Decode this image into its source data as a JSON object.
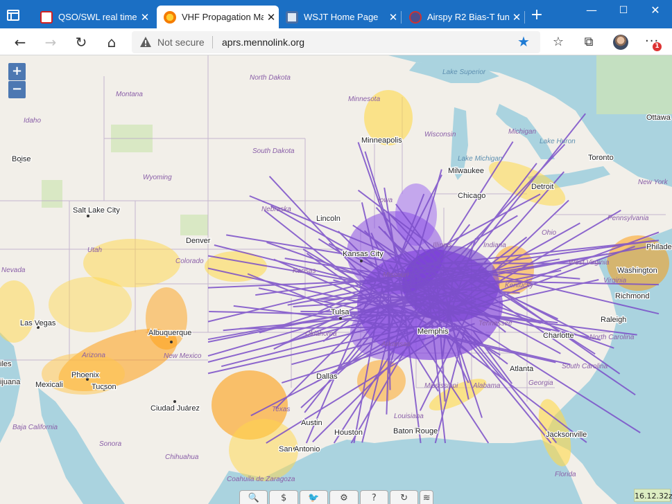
{
  "browser": {
    "tabs": [
      {
        "title": "QSO/SWL real time r",
        "fav_color": "#d32020"
      },
      {
        "title": "VHF Propagation Ma",
        "fav_color": "#f57c00"
      },
      {
        "title": "WSJT Home Page",
        "fav_color": "#4a6fa5"
      },
      {
        "title": "Airspy R2 Bias-T func",
        "fav_color": "#4e4e8c"
      }
    ],
    "active_tab": 1,
    "new_tab": "+",
    "controls": {
      "minimize": "—",
      "maximize": "☐",
      "close": "✕"
    }
  },
  "toolbar": {
    "back": "←",
    "forward": "→",
    "reload": "↻",
    "home": "⌂",
    "security_label": "Not secure",
    "url": "aprs.mennolink.org",
    "notification_count": "1",
    "more": "···",
    "favorites": "☆",
    "collections": "⧉"
  },
  "map": {
    "zoom_in": "+",
    "zoom_out": "−",
    "timestamp": "16.12.32z",
    "colors": {
      "water": "#aad3df",
      "land": "#f2efe9",
      "purple": "#7f3fe0",
      "yellow": "#ffd84a",
      "orange": "#ff9800"
    },
    "cities": [
      {
        "name": "Boise",
        "key": "boise"
      },
      {
        "name": "Salt Lake City",
        "key": "slc"
      },
      {
        "name": "Denver",
        "key": "denver"
      },
      {
        "name": "Las Vegas",
        "key": "lasvegas"
      },
      {
        "name": "Albuquerque",
        "key": "abq"
      },
      {
        "name": "Phoenix",
        "key": "phoenix"
      },
      {
        "name": "Tucson",
        "key": "tucson"
      },
      {
        "name": "Mexicali",
        "key": "mexicali"
      },
      {
        "name": "Ciudad Juárez",
        "key": "juarez"
      },
      {
        "name": "Minneapolis",
        "key": "minneapolis"
      },
      {
        "name": "Milwaukee",
        "key": "milwaukee"
      },
      {
        "name": "Chicago",
        "key": "chicago"
      },
      {
        "name": "Detroit",
        "key": "detroit"
      },
      {
        "name": "Toronto",
        "key": "toronto"
      },
      {
        "name": "Ottawa",
        "key": "ottawa"
      },
      {
        "name": "Lincoln",
        "key": "lincoln"
      },
      {
        "name": "Kansas City",
        "key": "kc"
      },
      {
        "name": "Tulsa",
        "key": "tulsa"
      },
      {
        "name": "Memphis",
        "key": "memphis"
      },
      {
        "name": "Dallas",
        "key": "dallas"
      },
      {
        "name": "Austin",
        "key": "austin"
      },
      {
        "name": "San Antonio",
        "key": "sanantonio"
      },
      {
        "name": "Houston",
        "key": "houston"
      },
      {
        "name": "Baton Rouge",
        "key": "batonrouge"
      },
      {
        "name": "Atlanta",
        "key": "atlanta"
      },
      {
        "name": "Charlotte",
        "key": "charlotte"
      },
      {
        "name": "Raleigh",
        "key": "raleigh"
      },
      {
        "name": "Richmond",
        "key": "richmond"
      },
      {
        "name": "Washington",
        "key": "washington"
      },
      {
        "name": "Jacksonville",
        "key": "jacksonville"
      },
      {
        "name": "Philade",
        "key": "philly"
      }
    ],
    "regions": [
      {
        "name": "North Dakota",
        "key": "nd"
      },
      {
        "name": "South Dakota",
        "key": "sd"
      },
      {
        "name": "Montana",
        "key": "mt"
      },
      {
        "name": "Idaho",
        "key": "id"
      },
      {
        "name": "Wyoming",
        "key": "wy"
      },
      {
        "name": "Nebraska",
        "key": "ne"
      },
      {
        "name": "Utah",
        "key": "ut"
      },
      {
        "name": "Colorado",
        "key": "co"
      },
      {
        "name": "Nevada",
        "key": "nv"
      },
      {
        "name": "Arizona",
        "key": "az"
      },
      {
        "name": "New Mexico",
        "key": "nm"
      },
      {
        "name": "Kansas",
        "key": "ks"
      },
      {
        "name": "Oklahoma",
        "key": "ok"
      },
      {
        "name": "Texas",
        "key": "tx"
      },
      {
        "name": "Iowa",
        "key": "ia"
      },
      {
        "name": "Minnesota",
        "key": "mn"
      },
      {
        "name": "Wisconsin",
        "key": "wi"
      },
      {
        "name": "Michigan",
        "key": "mi"
      },
      {
        "name": "Illinois",
        "key": "il"
      },
      {
        "name": "Indiana",
        "key": "in"
      },
      {
        "name": "Ohio",
        "key": "oh"
      },
      {
        "name": "Missouri",
        "key": "mo"
      },
      {
        "name": "Arkansas",
        "key": "ar"
      },
      {
        "name": "Tennessee",
        "key": "tn"
      },
      {
        "name": "Mississippi",
        "key": "ms"
      },
      {
        "name": "Alabama",
        "key": "al"
      },
      {
        "name": "Georgia",
        "key": "ga"
      },
      {
        "name": "South Carolina",
        "key": "sc"
      },
      {
        "name": "North Carolina",
        "key": "nc"
      },
      {
        "name": "Virginia",
        "key": "va"
      },
      {
        "name": "West Virginia",
        "key": "wv"
      },
      {
        "name": "Kentucky",
        "key": "ky"
      },
      {
        "name": "Louisiana",
        "key": "la"
      },
      {
        "name": "Florida",
        "key": "fl"
      },
      {
        "name": "Pennsylvania",
        "key": "pa"
      },
      {
        "name": "New York",
        "key": "ny"
      },
      {
        "name": "Sonora",
        "key": "sonora"
      },
      {
        "name": "Chihuahua",
        "key": "chihuahua"
      },
      {
        "name": "Coahuila de Zaragoza",
        "key": "coahuila"
      },
      {
        "name": "Baja California",
        "key": "baja"
      },
      {
        "name": "Lake Superior",
        "key": "lsup"
      },
      {
        "name": "Lake Michigan",
        "key": "lmich"
      },
      {
        "name": "Lake Huron",
        "key": "lhur"
      }
    ],
    "partial_labels": [
      {
        "name": "ijuana",
        "key": "tijuana"
      },
      {
        "name": "iles",
        "key": "angeles"
      }
    ]
  },
  "bottom_bar": {
    "buttons": [
      {
        "icon": "search-icon",
        "glyph": "🔍"
      },
      {
        "icon": "dollar-icon",
        "glyph": "$"
      },
      {
        "icon": "twitter-icon",
        "glyph": "🐦"
      },
      {
        "icon": "gear-icon",
        "glyph": "⚙"
      },
      {
        "icon": "help-icon",
        "glyph": "?"
      },
      {
        "icon": "refresh-icon",
        "glyph": "↻"
      },
      {
        "icon": "layers-icon",
        "glyph": "≋"
      }
    ]
  }
}
